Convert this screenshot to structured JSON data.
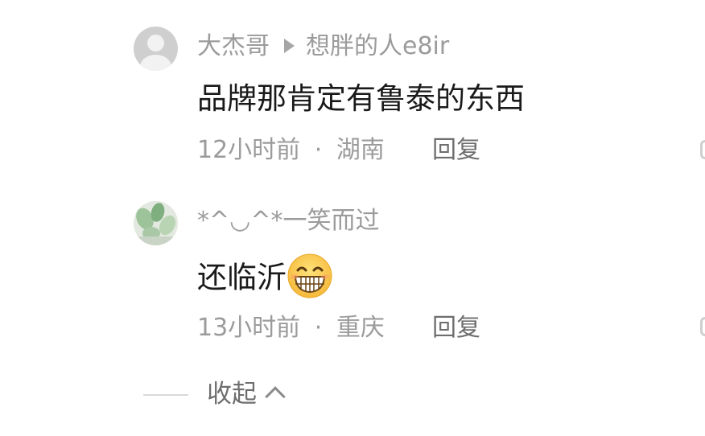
{
  "comments": [
    {
      "username": "大杰哥",
      "reply_to": "想胖的人e8ir",
      "text": "品牌那肯定有鲁泰的东西",
      "time": "12小时前",
      "location": "湖南",
      "reply_label": "回复"
    },
    {
      "username": "*^◡^*一笑而过",
      "text": "还临沂",
      "emoji": "grinning-face-emoji",
      "time": "13小时前",
      "location": "重庆",
      "reply_label": "回复"
    }
  ],
  "meta_separator": "·",
  "collapse_label": "收起",
  "colors": {
    "secondary_text": "#9b9b9b",
    "primary_text": "#1a1a1a",
    "action_text": "#6e6e6e"
  }
}
